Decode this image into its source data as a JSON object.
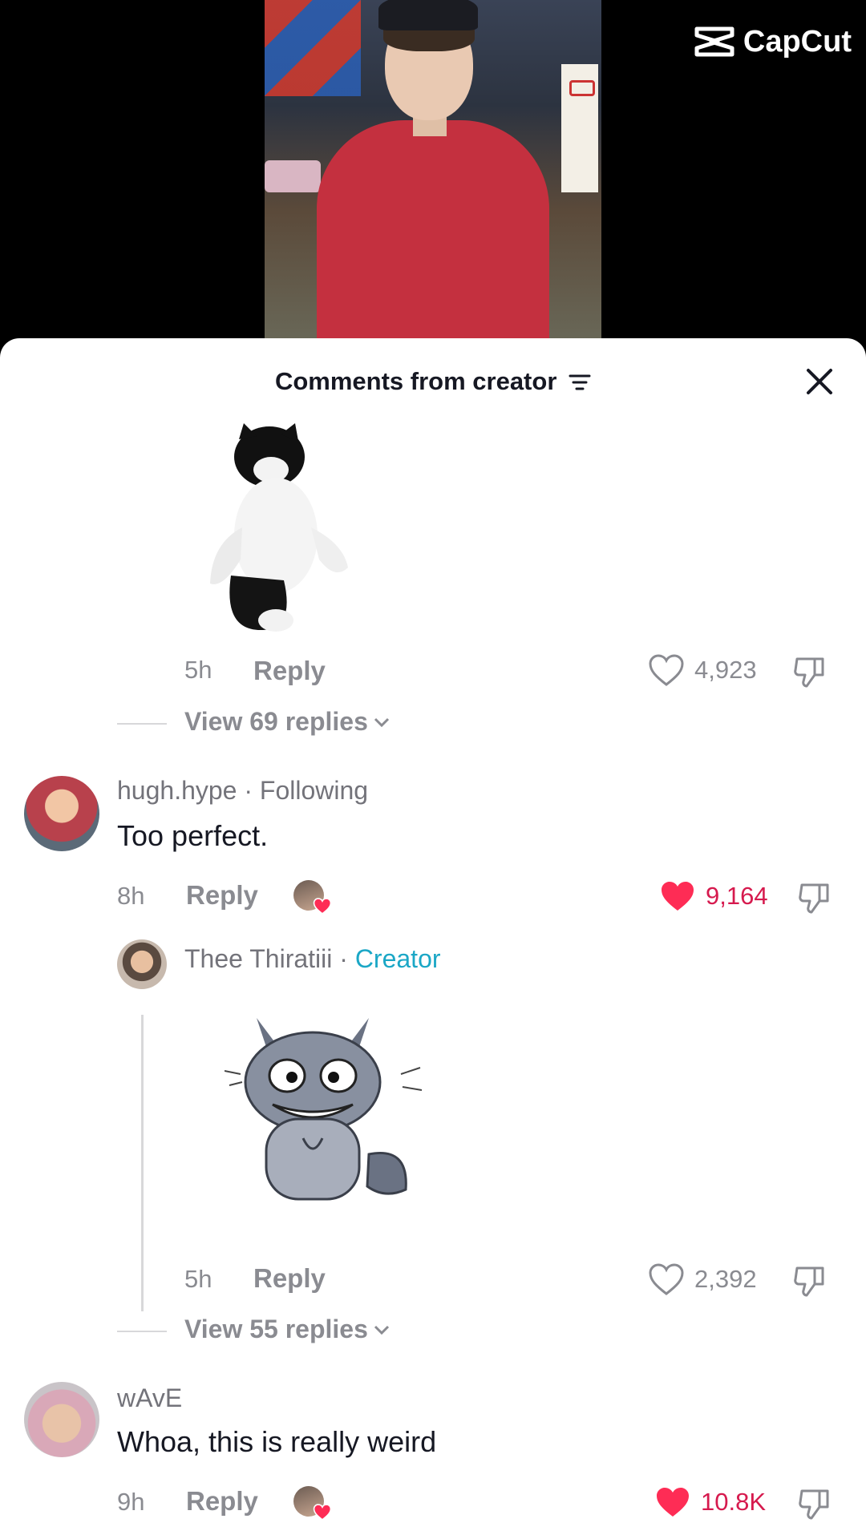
{
  "app": {
    "watermark": "CapCut"
  },
  "sheet": {
    "title": "Comments from creator"
  },
  "comments": [
    {
      "id": "c1",
      "sticker": "cat-sticker",
      "time": "5h",
      "reply_label": "Reply",
      "likes": "4,923",
      "liked": false,
      "view_replies": "View 69 replies"
    },
    {
      "id": "c2",
      "username": "hugh.hype",
      "badge": "Following",
      "text": "Too perfect.",
      "time": "8h",
      "reply_label": "Reply",
      "likes": "9,164",
      "liked": true,
      "reply": {
        "username": "Thee Thiratiii",
        "badge": "Creator",
        "sticker": "raccoon-sticker",
        "time": "5h",
        "reply_label": "Reply",
        "likes": "2,392",
        "liked": false
      },
      "view_replies": "View 55 replies"
    },
    {
      "id": "c3",
      "username": "wAvE",
      "text": "Whoa, this is really weird",
      "time": "9h",
      "reply_label": "Reply",
      "likes": "10.8K",
      "liked": true
    }
  ],
  "colors": {
    "accent_like": "#fe2c55",
    "creator": "#1ba7c6",
    "muted": "#8a8b91"
  }
}
